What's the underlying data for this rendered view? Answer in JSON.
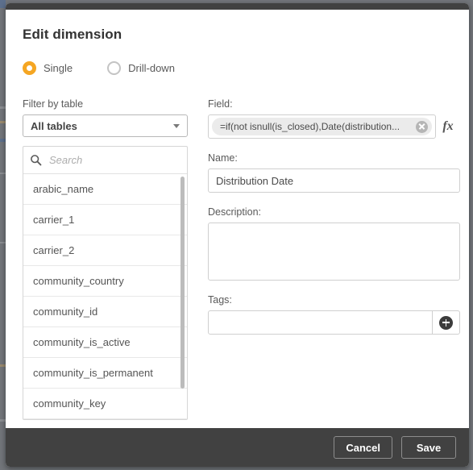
{
  "dialog": {
    "title": "Edit dimension"
  },
  "dimension_type": {
    "options": [
      {
        "label": "Single",
        "selected": true
      },
      {
        "label": "Drill-down",
        "selected": false
      }
    ]
  },
  "left_panel": {
    "filter_label": "Filter by table",
    "table_select": {
      "value": "All tables",
      "caret_icon": "chevron-down-icon"
    },
    "search": {
      "placeholder": "Search",
      "icon": "search-icon"
    },
    "fields": [
      "arabic_name",
      "carrier_1",
      "carrier_2",
      "community_country",
      "community_id",
      "community_is_active",
      "community_is_permanent",
      "community_key"
    ]
  },
  "right_panel": {
    "field_label": "Field:",
    "field_expression": "=if(not isnull(is_closed),Date(distribution...",
    "clear_icon": "clear-circle-icon",
    "fx_label": "fx",
    "name_label": "Name:",
    "name_value": "Distribution Date",
    "description_label": "Description:",
    "description_value": "",
    "tags_label": "Tags:",
    "tags_value": "",
    "add_tag_icon": "plus-circle-icon"
  },
  "footer": {
    "cancel_label": "Cancel",
    "save_label": "Save"
  },
  "colors": {
    "accent": "#f5a623",
    "chrome_dark": "#414141",
    "backdrop": "#72757a"
  }
}
